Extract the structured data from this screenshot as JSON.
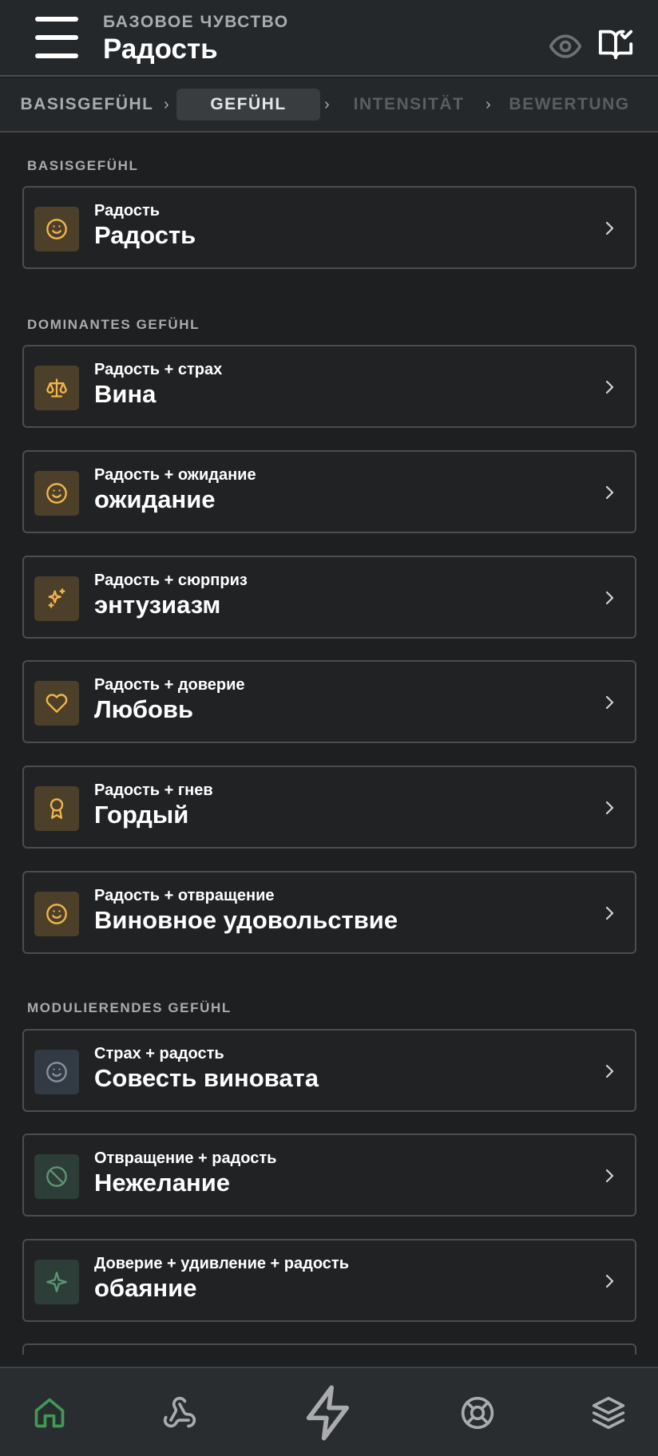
{
  "header": {
    "kicker": "БАЗОВОЕ ЧУВСТВО",
    "title": "Радость",
    "icons": [
      "menu-icon",
      "eye-icon",
      "book-check-icon"
    ]
  },
  "steps": [
    {
      "label": "BASISGEFÜHL",
      "state": "done"
    },
    {
      "label": "GEFÜHL",
      "state": "active"
    },
    {
      "label": "INTENSITÄT",
      "state": "pending"
    },
    {
      "label": "BEWERTUNG",
      "state": "pending"
    }
  ],
  "sections": {
    "basis": "BASISGEFÜHL",
    "dominant": "DOMINANTES GEFÜHL",
    "modulating": "MODULIERENDES GEFÜHL"
  },
  "cards": [
    {
      "sub": "Радость",
      "main": "Радость",
      "icon": "smile-icon",
      "accent": "#f0b64a"
    },
    {
      "sub": "Радость + страх",
      "main": "Вина",
      "icon": "scale-icon",
      "accent": "#f0b64a"
    },
    {
      "sub": "Радость + ожидание",
      "main": "ожидание",
      "icon": "smile-icon",
      "accent": "#f0b64a"
    },
    {
      "sub": "Радость + сюрприз",
      "main": "энтузиазм",
      "icon": "sparkles-icon",
      "accent": "#f0b64a"
    },
    {
      "sub": "Радость + доверие",
      "main": "Любовь",
      "icon": "heart-icon",
      "accent": "#f0b64a"
    },
    {
      "sub": "Радость + гнев",
      "main": "Гордый",
      "icon": "award-icon",
      "accent": "#f0b64a"
    },
    {
      "sub": "Радость + отвращение",
      "main": "Виновное удовольствие",
      "icon": "smile-icon",
      "accent": "#f0b64a"
    },
    {
      "sub": "Страх + радость",
      "main": "Совесть виновата",
      "icon": "smile-icon",
      "accent": "#8791a0"
    },
    {
      "sub": "Отвращение + радость",
      "main": "Нежелание",
      "icon": "ban-icon",
      "accent": "#5d9575"
    },
    {
      "sub": "Доверие + удивление + радость",
      "main": "обаяние",
      "icon": "sparkle-icon",
      "accent": "#5d9575"
    }
  ],
  "bottom_nav": [
    {
      "icon": "home-icon",
      "active": true,
      "accent": "#3f9a55"
    },
    {
      "icon": "webhook-icon",
      "active": false
    },
    {
      "icon": "zap-icon",
      "active": false
    },
    {
      "icon": "lifebuoy-icon",
      "active": false
    },
    {
      "icon": "layers-icon",
      "active": false
    }
  ]
}
